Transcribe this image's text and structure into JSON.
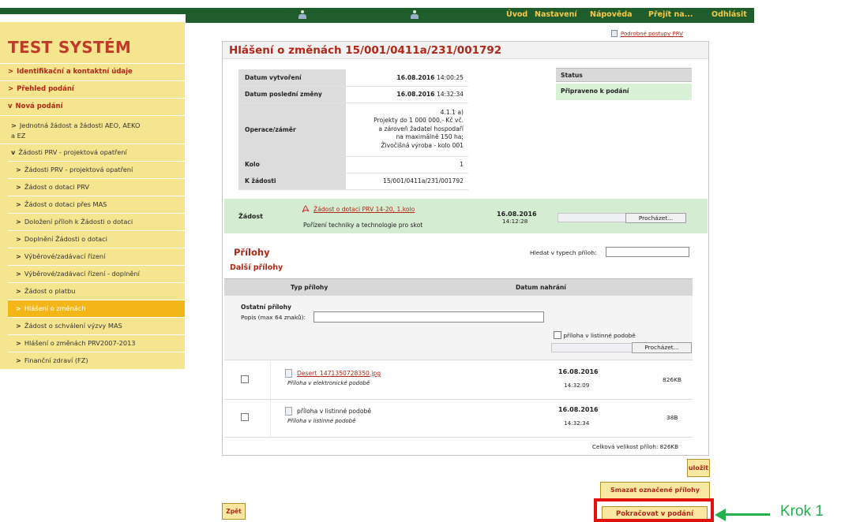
{
  "topnav": {
    "items": [
      "Úvod",
      "Nastavení",
      "Nápověda",
      "Přejít na...",
      "Odhlásit"
    ]
  },
  "sidebar": {
    "brand": "TEST SYSTÉM",
    "sections": [
      {
        "label": "Identifikační a kontaktní údaje",
        "arrow": ">"
      },
      {
        "label": "Přehled podání",
        "arrow": ">"
      },
      {
        "label": "Nová podání",
        "arrow": "v"
      }
    ],
    "sub_items": [
      {
        "label": "Jednotná žádost a žádosti AEO, AEKO",
        "label2": "a EZ",
        "arrow": ">"
      },
      {
        "label": "Žádosti PRV - projektová opatření",
        "arrow": "v"
      }
    ],
    "sub2_items": [
      {
        "label": "Žádosti PRV - projektová opatření",
        "active": false
      },
      {
        "label": "Žádost o dotaci PRV",
        "active": false
      },
      {
        "label": "Žádost o dotaci přes MAS",
        "active": false
      },
      {
        "label": "Doložení příloh k Žádosti o dotaci",
        "active": false
      },
      {
        "label": "Doplnění Žádosti o dotaci",
        "active": false
      },
      {
        "label": "Výběrové/zadávací řízení",
        "active": false
      },
      {
        "label": "Výběrové/zadávací řízení - doplnění",
        "active": false
      },
      {
        "label": "Žádost o platbu",
        "active": false
      },
      {
        "label": "Hlášení o změnách",
        "active": true
      },
      {
        "label": "Žádost o schválení výzvy MAS",
        "active": false
      },
      {
        "label": "Hlášení o změnách PRV2007-2013",
        "active": false
      },
      {
        "label": "Finanční zdraví (FZ)",
        "active": false
      }
    ]
  },
  "main": {
    "manual_link": "Podrobné postupy PRV",
    "title": "Hlášení o změnách 15/001/0411a/231/001792",
    "info": {
      "datum_vytvoreni_label": "Datum vytvoření",
      "datum_vytvoreni_date": "16.08.2016",
      "datum_vytvoreni_time": "14:00:25",
      "datum_zmeny_label": "Datum poslední změny",
      "datum_zmeny_date": "16.08.2016",
      "datum_zmeny_time": "14:32:34",
      "operace_label": "Operace/záměr",
      "operace_lines": [
        "4.1.1 a)",
        "Projekty do 1 000 000,- Kč vč.",
        "a zároveň žadatel hospodaří",
        "na maximálně 150 ha;",
        "Živočišná výroba - kolo 001"
      ],
      "kolo_label": "Kolo",
      "kolo_value": "1",
      "k_zadosti_label": "K žádosti",
      "k_zadosti_value": "15/001/0411a/231/001792"
    },
    "status": {
      "label": "Status",
      "value": "Připraveno k podání"
    },
    "zadost": {
      "label": "Žádost",
      "link": "Žádost o dotaci PRV 14-20, 1.kolo",
      "description": "Pořízení techniky a technologie pro skot",
      "date": "16.08.2016",
      "time": "14:12:28",
      "browse": "Procházet..."
    },
    "prilohy_heading": "Přílohy",
    "dalsi_heading": "Další přílohy",
    "search_label": "Hledat v typech příloh:",
    "search_value": "",
    "columns": {
      "typ": "Typ přílohy",
      "datum": "Datum nahrání"
    },
    "other": {
      "title": "Ostatní přílohy",
      "popis_label": "Popis (max 64 znaků):",
      "popis_value": "",
      "listinna_label": "příloha v listinné podobě",
      "browse": "Procházet..."
    },
    "rows": [
      {
        "name": "Desert_1471350728350.jpg",
        "desc": "Příloha v elektronické podobě",
        "date": "16.08.2016",
        "time": "14:32:09",
        "size": "826KB"
      },
      {
        "name": "příloha v listinné podobě",
        "desc": "Příloha v listinné podobě",
        "date": "16.08.2016",
        "time": "14:32:34",
        "size": "38B"
      }
    ],
    "total": "Celková velikost příloh: 826KB"
  },
  "buttons": {
    "save": "uložit",
    "delete_selected": "Smazat označené přílohy",
    "continue": "Pokračovat v podání",
    "back": "Zpět"
  },
  "annotation": {
    "label": "Krok 1",
    "color": "#22b14c",
    "frame_color": "#e3110d"
  }
}
